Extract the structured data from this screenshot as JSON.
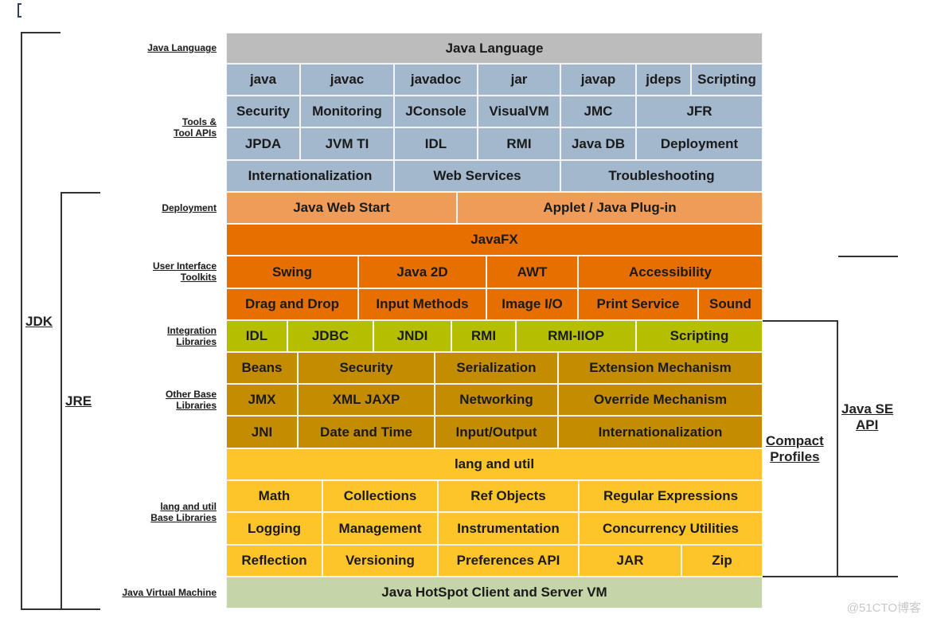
{
  "colors": {
    "language": "#bcbcbc",
    "tools": "#a3b8cc",
    "deployment": "#ee9c57",
    "ui_toolkits": "#e76f00",
    "integration": "#b5bf00",
    "other_base": "#c48c00",
    "lang_util": "#fec52b",
    "jvm": "#c5d5a9"
  },
  "left_labels": {
    "java_language": "Java Language",
    "tools_line1": "Tools &",
    "tools_line2": "Tool APIs",
    "deployment": "Deployment",
    "ui_line1": "User Interface",
    "ui_line2": "Toolkits",
    "integration_line1": "Integration",
    "integration_line2": "Libraries",
    "other_line1": "Other Base",
    "other_line2": "Libraries",
    "lang_line1": "lang and util",
    "lang_line2": "Base Libraries",
    "jvm": "Java Virtual Machine"
  },
  "brackets": {
    "jdk": "JDK",
    "jre": "JRE",
    "compact_line1": "Compact",
    "compact_line2": "Profiles",
    "javase_line1": "Java SE",
    "javase_line2": "API"
  },
  "rows": [
    {
      "group": "language",
      "cells": [
        {
          "label": "Java Language"
        }
      ]
    },
    {
      "group": "tools",
      "cells": [
        {
          "label": "java"
        },
        {
          "label": "javac"
        },
        {
          "label": "javadoc"
        },
        {
          "label": "jar"
        },
        {
          "label": "javap"
        },
        {
          "label": "jdeps"
        },
        {
          "label": "Scripting"
        }
      ]
    },
    {
      "group": "tools",
      "cells": [
        {
          "label": "Security"
        },
        {
          "label": "Monitoring"
        },
        {
          "label": "JConsole"
        },
        {
          "label": "VisualVM"
        },
        {
          "label": "JMC"
        },
        {
          "label": "JFR"
        }
      ]
    },
    {
      "group": "tools",
      "cells": [
        {
          "label": "JPDA"
        },
        {
          "label": "JVM TI"
        },
        {
          "label": "IDL"
        },
        {
          "label": "RMI"
        },
        {
          "label": "Java DB"
        },
        {
          "label": "Deployment"
        }
      ]
    },
    {
      "group": "tools",
      "cells": [
        {
          "label": "Internationalization"
        },
        {
          "label": "Web Services"
        },
        {
          "label": "Troubleshooting"
        }
      ]
    },
    {
      "group": "deployment",
      "cells": [
        {
          "label": "Java Web Start"
        },
        {
          "label": "Applet / Java Plug-in"
        }
      ]
    },
    {
      "group": "ui_toolkits",
      "cells": [
        {
          "label": "JavaFX"
        }
      ]
    },
    {
      "group": "ui_toolkits",
      "cells": [
        {
          "label": "Swing"
        },
        {
          "label": "Java 2D"
        },
        {
          "label": "AWT"
        },
        {
          "label": "Accessibility"
        }
      ]
    },
    {
      "group": "ui_toolkits",
      "cells": [
        {
          "label": "Drag and Drop"
        },
        {
          "label": "Input Methods"
        },
        {
          "label": "Image I/O"
        },
        {
          "label": "Print Service"
        },
        {
          "label": "Sound"
        }
      ]
    },
    {
      "group": "integration",
      "cells": [
        {
          "label": "IDL"
        },
        {
          "label": "JDBC"
        },
        {
          "label": "JNDI"
        },
        {
          "label": "RMI"
        },
        {
          "label": "RMI-IIOP"
        },
        {
          "label": "Scripting"
        }
      ]
    },
    {
      "group": "other_base",
      "cells": [
        {
          "label": "Beans"
        },
        {
          "label": "Security"
        },
        {
          "label": "Serialization"
        },
        {
          "label": "Extension Mechanism"
        }
      ]
    },
    {
      "group": "other_base",
      "cells": [
        {
          "label": "JMX"
        },
        {
          "label": "XML JAXP"
        },
        {
          "label": "Networking"
        },
        {
          "label": "Override Mechanism"
        }
      ]
    },
    {
      "group": "other_base",
      "cells": [
        {
          "label": "JNI"
        },
        {
          "label": "Date and Time"
        },
        {
          "label": "Input/Output"
        },
        {
          "label": "Internationalization"
        }
      ]
    },
    {
      "group": "lang_util",
      "cells": [
        {
          "label": "lang and util"
        }
      ]
    },
    {
      "group": "lang_util",
      "cells": [
        {
          "label": "Math"
        },
        {
          "label": "Collections"
        },
        {
          "label": "Ref Objects"
        },
        {
          "label": "Regular Expressions"
        }
      ]
    },
    {
      "group": "lang_util",
      "cells": [
        {
          "label": "Logging"
        },
        {
          "label": "Management"
        },
        {
          "label": "Instrumentation"
        },
        {
          "label": "Concurrency Utilities"
        }
      ]
    },
    {
      "group": "lang_util",
      "cells": [
        {
          "label": "Reflection"
        },
        {
          "label": "Versioning"
        },
        {
          "label": "Preferences API"
        },
        {
          "label": "JAR"
        },
        {
          "label": "Zip"
        }
      ]
    },
    {
      "group": "jvm",
      "cells": [
        {
          "label": "Java HotSpot Client and Server VM"
        }
      ]
    }
  ],
  "watermark": "@51CTO博客"
}
